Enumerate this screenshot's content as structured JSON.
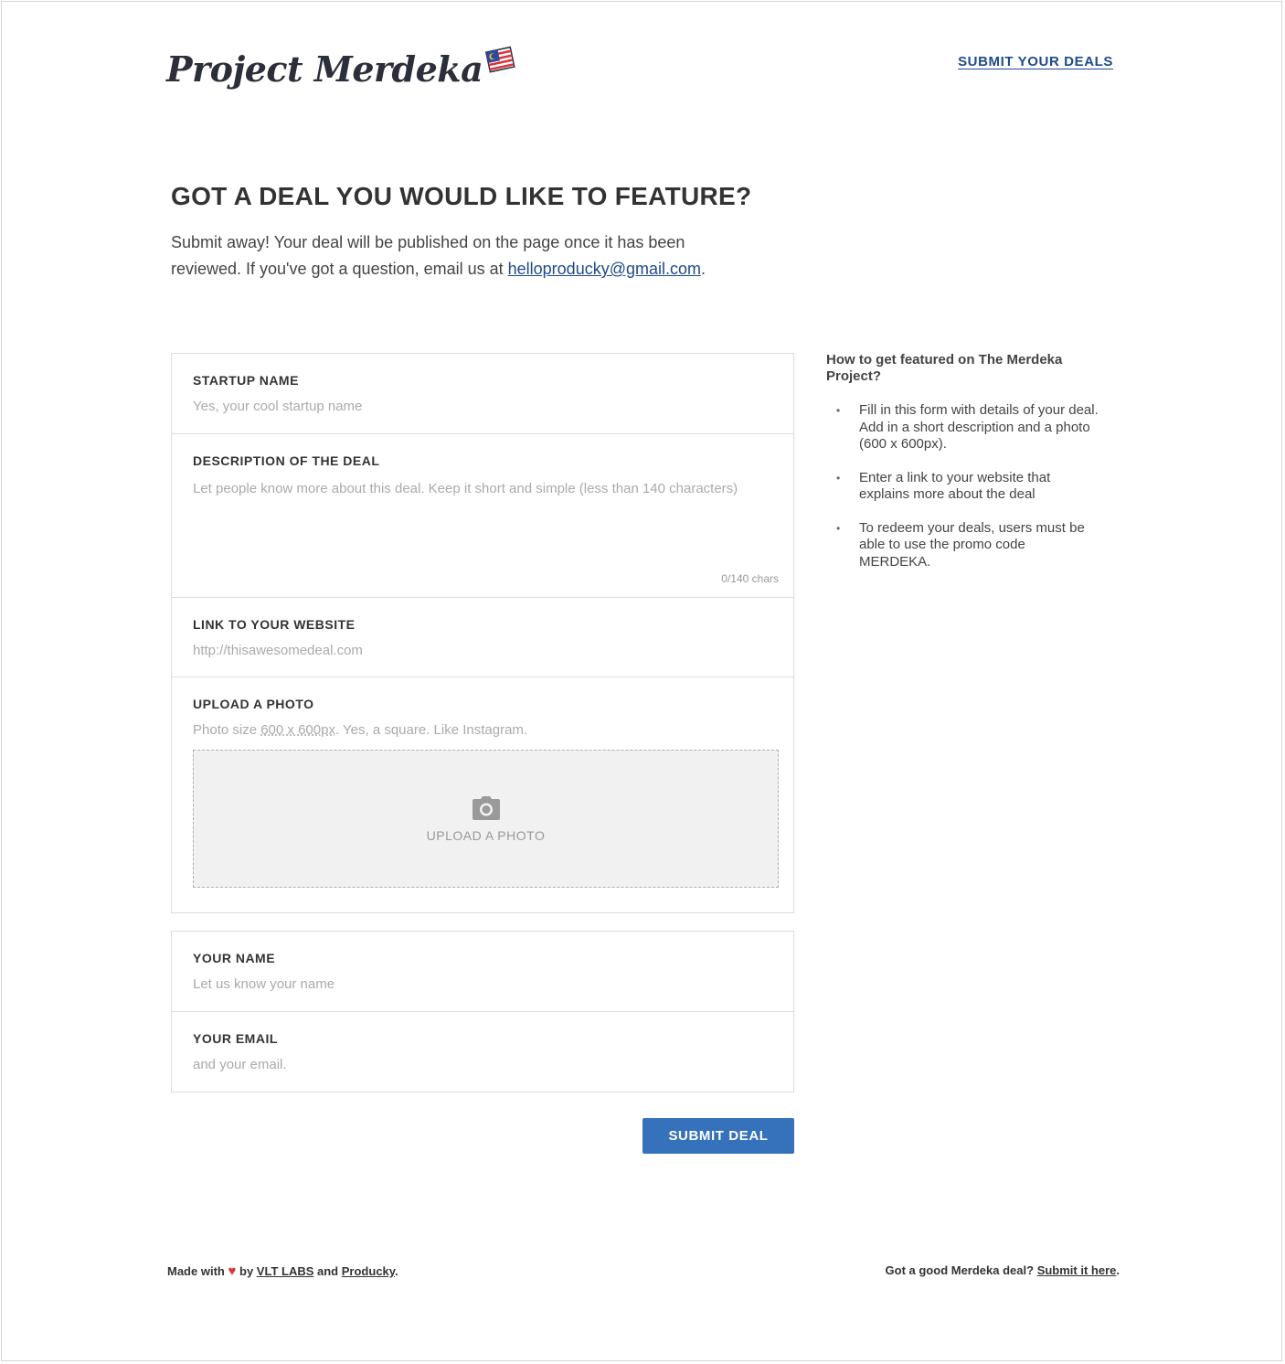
{
  "header": {
    "logo_text": "Project Merdeka",
    "nav_link": "SUBMIT YOUR DEALS"
  },
  "hero": {
    "title": "GOT A DEAL YOU WOULD LIKE TO FEATURE?",
    "desc_prefix": "Submit away! Your deal will be published on the page once it has been reviewed. If you've got a question, email us at ",
    "email": "helloproducky@gmail.com",
    "desc_suffix": "."
  },
  "form": {
    "startup": {
      "label": "STARTUP NAME",
      "placeholder": "Yes, your cool startup name"
    },
    "description": {
      "label": "DESCRIPTION OF THE DEAL",
      "placeholder": "Let people know more about this deal. Keep it short and simple (less than 140 characters)",
      "counter": "0/140 chars"
    },
    "link": {
      "label": "LINK TO YOUR WEBSITE",
      "placeholder": "http://thisawesomedeal.com"
    },
    "photo": {
      "label": "UPLOAD A PHOTO",
      "hint_prefix": "Photo size ",
      "hint_size": "600 x 600px",
      "hint_suffix": ". Yes, a square. Like Instagram.",
      "dropzone_label": "UPLOAD A PHOTO"
    },
    "name": {
      "label": "YOUR NAME",
      "placeholder": "Let us know your name"
    },
    "email": {
      "label": "YOUR EMAIL",
      "placeholder": "and your email."
    },
    "submit_label": "SUBMIT DEAL"
  },
  "sidebar": {
    "title": "How to get featured on The Merdeka Project?",
    "items": [
      "Fill in this form with details of your deal. Add in a short description and a photo (600 x 600px).",
      "Enter a link to your website that explains more about the deal",
      "To redeem your deals, users must be able to use the promo code MERDEKA."
    ]
  },
  "footer": {
    "made_with": "Made with",
    "by": "by",
    "vlt": "VLT LABS",
    "and": "and",
    "producky": "Producky",
    "period": ".",
    "right_text": "Got a good Merdeka deal?",
    "right_link": "Submit it here",
    "right_period": "."
  },
  "colors": {
    "accent": "#3572bb",
    "link": "#1f4a8a",
    "heart": "#e0343b"
  },
  "icons": [
    "camera-icon",
    "heart-icon",
    "flag-icon"
  ]
}
